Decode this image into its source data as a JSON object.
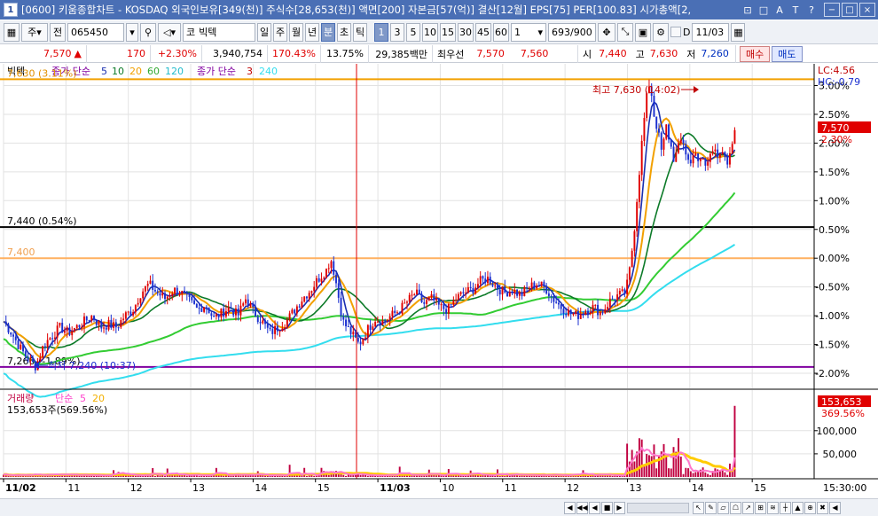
{
  "window": {
    "number": "1",
    "title": "[0600] 키움종합차트 - KOSDAQ 외국인보유[349(천)] 주식수[28,653(천)] 액면[200] 자본금[57(억)] 결산[12월] EPS[75] PER[100.83] 시가총액[2,",
    "controls": [
      "⊡",
      "□",
      "A",
      "T",
      "?"
    ],
    "win_buttons": [
      "−",
      "□",
      "×"
    ]
  },
  "toolbar": {
    "market": "주",
    "prev": "전",
    "code": "065450",
    "name_prefix": "코",
    "name": "빅텍",
    "periods": [
      "일",
      "주",
      "월",
      "년",
      "분",
      "초",
      "틱"
    ],
    "active_period": "분",
    "intervals": [
      "1",
      "3",
      "5",
      "10",
      "15",
      "30",
      "45",
      "60"
    ],
    "active_interval": "1",
    "count_value": "1",
    "range": "693/900",
    "date_label": "D",
    "date": "11/03"
  },
  "info": {
    "price": "7,570",
    "arrow": "▲",
    "change": "170",
    "change_pct": "+2.30%",
    "volume": "3,940,754",
    "vol_ratio": "170.43%",
    "turnover": "13.75%",
    "amount": "29,385백만",
    "quote_label": "최우선",
    "ask": "7,570",
    "bid": "7,560",
    "open_label": "시",
    "open": "7,440",
    "high_label": "고",
    "high": "7,630",
    "low_label": "저",
    "low": "7,260",
    "buy": "매수",
    "sell": "매도"
  },
  "colors": {
    "price_up": "#e00000",
    "price_down": "#1a2fd0",
    "ma5": "#1a2fb0",
    "ma10": "#f2a000",
    "ma20": "#0c7a28",
    "ma60": "#33cc33",
    "ma120": "#33ddee",
    "vol_bar": "#c00040",
    "vol_ma5": "#ff77cc",
    "vol_ma20": "#ffcc00"
  },
  "chart_data": [
    {
      "type": "line",
      "name": "price",
      "legend": {
        "title": "빅텍",
        "ma_label": "종가 단순",
        "ma_periods": [
          "5",
          "10",
          "20",
          "60",
          "120"
        ],
        "ma2_label": "종가 단순",
        "ma2_periods": [
          "3",
          "240"
        ]
      },
      "y_ticks": [
        "3.00%",
        "2.50%",
        "2.00%",
        "1.50%",
        "1.00%",
        "0.50%",
        "0.00%",
        "-0.50%",
        "-1.00%",
        "-1.50%",
        "-2.00%"
      ],
      "ylim": [
        -2.2,
        3.1
      ],
      "lc_label": "LC:4.56",
      "hc_label": "HC:-0.79",
      "current_price": "7,570",
      "current_pct": "2.30%",
      "h_lines": [
        {
          "label": "7,630 (3.11%)",
          "pct": 3.11,
          "color": "#f2a000"
        },
        {
          "label": "7,440 (0.54%)",
          "pct": 0.54,
          "color": "#000000"
        },
        {
          "label": "7,400",
          "pct": 0.0,
          "color": "#ffb060"
        },
        {
          "label": "7,260 (-1.89%)",
          "pct": -1.89,
          "color": "#8000a0"
        }
      ],
      "annotations": [
        {
          "text": "최고 7,630 (14:02)",
          "pct": 3.11
        },
        {
          "text": "최저 7,240 (10:37)",
          "pct": -1.89
        }
      ],
      "close_path": [
        [
          0.0,
          -1.1
        ],
        [
          0.01,
          -1.3
        ],
        [
          0.02,
          -1.55
        ],
        [
          0.03,
          -1.75
        ],
        [
          0.04,
          -1.88
        ],
        [
          0.05,
          -1.5
        ],
        [
          0.06,
          -1.35
        ],
        [
          0.07,
          -1.2
        ],
        [
          0.08,
          -1.3
        ],
        [
          0.09,
          -1.2
        ],
        [
          0.1,
          -1.1
        ],
        [
          0.11,
          -1.0
        ],
        [
          0.12,
          -1.2
        ],
        [
          0.13,
          -1.15
        ],
        [
          0.14,
          -1.2
        ],
        [
          0.15,
          -1.0
        ],
        [
          0.16,
          -0.9
        ],
        [
          0.17,
          -0.6
        ],
        [
          0.18,
          -0.45
        ],
        [
          0.19,
          -0.6
        ],
        [
          0.2,
          -0.7
        ],
        [
          0.21,
          -0.55
        ],
        [
          0.22,
          -0.6
        ],
        [
          0.23,
          -0.75
        ],
        [
          0.24,
          -0.9
        ],
        [
          0.25,
          -0.8
        ],
        [
          0.26,
          -1.05
        ],
        [
          0.27,
          -0.95
        ],
        [
          0.28,
          -0.85
        ],
        [
          0.29,
          -1.0
        ],
        [
          0.3,
          -0.7
        ],
        [
          0.31,
          -0.95
        ],
        [
          0.32,
          -1.1
        ],
        [
          0.33,
          -1.3
        ],
        [
          0.34,
          -1.2
        ],
        [
          0.35,
          -1.1
        ],
        [
          0.36,
          -0.9
        ],
        [
          0.37,
          -0.7
        ],
        [
          0.38,
          -0.55
        ],
        [
          0.39,
          -0.35
        ],
        [
          0.4,
          -0.2
        ],
        [
          0.405,
          0.0
        ],
        [
          0.41,
          -0.3
        ],
        [
          0.415,
          -0.7
        ],
        [
          0.42,
          -1.1
        ],
        [
          0.43,
          -1.3
        ],
        [
          0.44,
          -1.5
        ],
        [
          0.45,
          -1.25
        ],
        [
          0.46,
          -1.05
        ],
        [
          0.47,
          -1.1
        ],
        [
          0.48,
          -1.0
        ],
        [
          0.49,
          -0.9
        ],
        [
          0.5,
          -0.75
        ],
        [
          0.51,
          -0.6
        ],
        [
          0.52,
          -0.8
        ],
        [
          0.53,
          -0.7
        ],
        [
          0.54,
          -0.85
        ],
        [
          0.55,
          -0.9
        ],
        [
          0.56,
          -0.7
        ],
        [
          0.57,
          -0.6
        ],
        [
          0.58,
          -0.55
        ],
        [
          0.59,
          -0.4
        ],
        [
          0.6,
          -0.35
        ],
        [
          0.61,
          -0.5
        ],
        [
          0.62,
          -0.6
        ],
        [
          0.63,
          -0.55
        ],
        [
          0.64,
          -0.65
        ],
        [
          0.65,
          -0.5
        ],
        [
          0.66,
          -0.45
        ],
        [
          0.67,
          -0.5
        ],
        [
          0.68,
          -0.7
        ],
        [
          0.69,
          -0.85
        ],
        [
          0.7,
          -0.95
        ],
        [
          0.71,
          -1.0
        ],
        [
          0.72,
          -0.9
        ],
        [
          0.73,
          -0.85
        ],
        [
          0.74,
          -0.95
        ],
        [
          0.75,
          -0.75
        ],
        [
          0.76,
          -0.65
        ],
        [
          0.77,
          -0.6
        ],
        [
          0.775,
          -0.2
        ],
        [
          0.78,
          0.4
        ],
        [
          0.785,
          1.2
        ],
        [
          0.79,
          2.0
        ],
        [
          0.795,
          2.7
        ],
        [
          0.8,
          3.1
        ],
        [
          0.805,
          2.5
        ],
        [
          0.81,
          2.2
        ],
        [
          0.815,
          1.8
        ],
        [
          0.82,
          2.3
        ],
        [
          0.825,
          2.0
        ],
        [
          0.83,
          1.7
        ],
        [
          0.835,
          1.9
        ],
        [
          0.84,
          2.1
        ],
        [
          0.845,
          1.8
        ],
        [
          0.85,
          1.6
        ],
        [
          0.855,
          1.95
        ],
        [
          0.86,
          1.6
        ],
        [
          0.865,
          1.75
        ],
        [
          0.87,
          1.55
        ],
        [
          0.875,
          1.85
        ],
        [
          0.88,
          2.0
        ],
        [
          0.885,
          1.7
        ],
        [
          0.89,
          1.8
        ],
        [
          0.895,
          1.6
        ],
        [
          0.9,
          1.8
        ],
        [
          0.905,
          2.3
        ]
      ]
    },
    {
      "type": "bar",
      "name": "volume",
      "legend": {
        "title": "거래량",
        "ma_label": "단순",
        "ma_periods": [
          "5",
          "20"
        ]
      },
      "info_label": "153,653주(569.56%)",
      "current_label": "153,653",
      "current_pct": "369.56%",
      "y_ticks": [
        "100,000",
        "50,000"
      ],
      "ylim": [
        0,
        180000
      ]
    }
  ],
  "x_axis": {
    "labels": [
      "11/02",
      "11",
      "12",
      "13",
      "14",
      "15",
      "11/03",
      "10",
      "11",
      "12",
      "13",
      "14",
      "15"
    ],
    "day_divider_label": "11/03",
    "end_label": "15:30:00"
  },
  "statusbar": {
    "nav_icons": [
      "◀",
      "◀◀",
      "◀",
      "■",
      "▶"
    ],
    "tool_icons": [
      "↖",
      "✎",
      "▱",
      "☖",
      "↗",
      "⊞",
      "≋",
      "┼",
      "▲",
      "⊕",
      "✖",
      "◀"
    ]
  }
}
